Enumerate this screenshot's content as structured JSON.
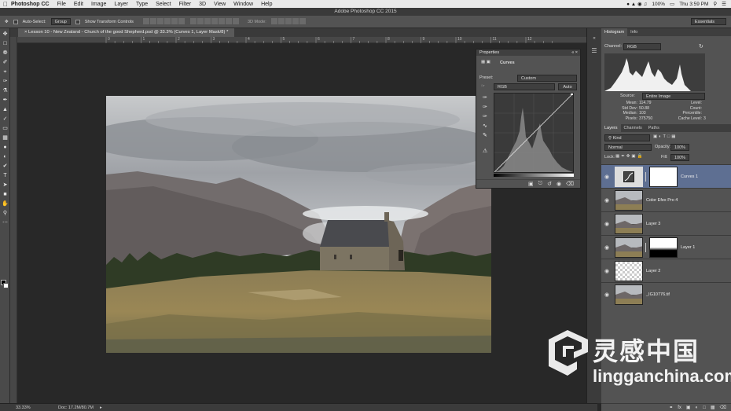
{
  "menubar": {
    "app_name": "Photoshop CC",
    "items": [
      "File",
      "Edit",
      "Image",
      "Layer",
      "Type",
      "Select",
      "Filter",
      "3D",
      "View",
      "Window",
      "Help"
    ],
    "battery": "100%",
    "clock": "Thu 3:59 PM"
  },
  "window": {
    "title": "Adobe Photoshop CC 2015"
  },
  "options_bar": {
    "auto_select_label": "Auto-Select:",
    "auto_select_value": "Group",
    "show_transform_label": "Show Transform Controls",
    "mode_3d": "3D Mode:",
    "workspace": "Essentials"
  },
  "document": {
    "tab_title": "Lesson 10 - New Zealand - Church of the good Shepherd.psd @ 33.3% (Curves 1, Layer Mask/8) *",
    "ruler_numbers": [
      "0",
      "1",
      "2",
      "3",
      "4",
      "5",
      "6",
      "7",
      "8",
      "9",
      "10",
      "11",
      "12"
    ]
  },
  "status": {
    "zoom": "33.33%",
    "doc_size": "Doc: 17.2M/80.7M"
  },
  "properties": {
    "panel_title": "Properties",
    "adjustment_name": "Curves",
    "preset_label": "Preset:",
    "preset_value": "Custom",
    "channel_value": "RGB",
    "auto_button": "Auto"
  },
  "histogram": {
    "tabs": [
      "Histogram",
      "Info"
    ],
    "channel_label": "Channel:",
    "channel_value": "RGB",
    "source_label": "Source:",
    "source_value": "Entire Image",
    "stats_left": [
      {
        "k": "Mean:",
        "v": "114.79"
      },
      {
        "k": "Std Dev:",
        "v": "50.88"
      },
      {
        "k": "Median:",
        "v": "103"
      },
      {
        "k": "Pixels:",
        "v": "375750"
      }
    ],
    "stats_right": [
      {
        "k": "Level:",
        "v": ""
      },
      {
        "k": "Count:",
        "v": ""
      },
      {
        "k": "Percentile:",
        "v": ""
      },
      {
        "k": "Cache Level:",
        "v": "3"
      }
    ]
  },
  "layers_panel": {
    "tabs": [
      "Layers",
      "Channels",
      "Paths"
    ],
    "filter_value": "Kind",
    "blend_mode": "Normal",
    "opacity_label": "Opacity:",
    "opacity_value": "100%",
    "lock_label": "Lock:",
    "fill_label": "Fill:",
    "fill_value": "100%",
    "layers": [
      {
        "name": "Curves 1"
      },
      {
        "name": "Color Efex Pro 4"
      },
      {
        "name": "Layer 3"
      },
      {
        "name": "Layer 1"
      },
      {
        "name": "Layer 2"
      },
      {
        "name": "_IG10776.tif"
      }
    ]
  },
  "watermark": {
    "cn": "灵感中国",
    "en": "lingganchina.com"
  }
}
